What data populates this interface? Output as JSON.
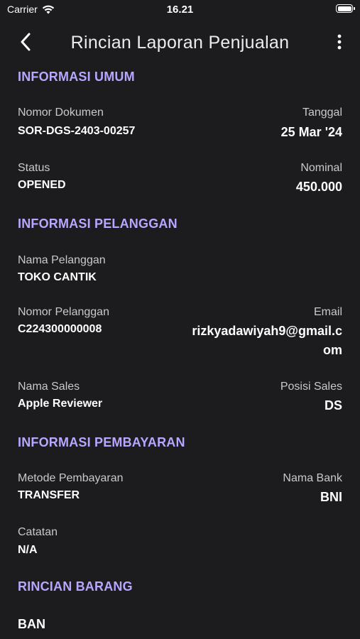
{
  "status_bar": {
    "carrier": "Carrier",
    "time": "16.21"
  },
  "nav": {
    "title": "Rincian Laporan Penjualan",
    "back_icon": "chevron-left-icon",
    "more_icon": "more-vertical-icon"
  },
  "sections": {
    "umum": {
      "title": "INFORMASI UMUM",
      "nomor_dokumen_label": "Nomor Dokumen",
      "nomor_dokumen_value": "SOR-DGS-2403-00257",
      "tanggal_label": "Tanggal",
      "tanggal_value": "25 Mar '24",
      "status_label": "Status",
      "status_value": "OPENED",
      "nominal_label": "Nominal",
      "nominal_value": "450.000"
    },
    "pelanggan": {
      "title": "INFORMASI PELANGGAN",
      "nama_label": "Nama Pelanggan",
      "nama_value": "TOKO CANTIK",
      "nomor_label": "Nomor Pelanggan",
      "nomor_value": "C224300000008",
      "email_label": "Email",
      "email_value": "rizkyadawiyah9@gmail.com",
      "sales_label": "Nama Sales",
      "sales_value": "Apple Reviewer",
      "posisi_label": "Posisi Sales",
      "posisi_value": "DS"
    },
    "pembayaran": {
      "title": "INFORMASI PEMBAYARAN",
      "metode_label": "Metode Pembayaran",
      "metode_value": "TRANSFER",
      "bank_label": "Nama Bank",
      "bank_value": "BNI",
      "catatan_label": "Catatan",
      "catatan_value": "N/A"
    },
    "barang": {
      "title": "RINCIAN BARANG",
      "first_item": "BAN"
    }
  },
  "colors": {
    "background": "#1c1c1e",
    "accent": "#b9a6ff",
    "label": "#c9c9cc",
    "value": "#ffffff"
  }
}
